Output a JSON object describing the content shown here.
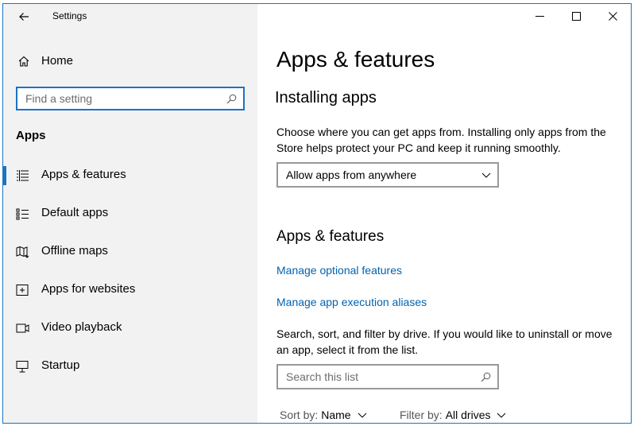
{
  "window": {
    "title": "Settings"
  },
  "sidebar": {
    "home_label": "Home",
    "search_placeholder": "Find a setting",
    "section_label": "Apps",
    "items": [
      {
        "label": "Apps & features",
        "icon": "apps-features-icon",
        "selected": true
      },
      {
        "label": "Default apps",
        "icon": "default-apps-icon",
        "selected": false
      },
      {
        "label": "Offline maps",
        "icon": "offline-maps-icon",
        "selected": false
      },
      {
        "label": "Apps for websites",
        "icon": "apps-websites-icon",
        "selected": false
      },
      {
        "label": "Video playback",
        "icon": "video-playback-icon",
        "selected": false
      },
      {
        "label": "Startup",
        "icon": "startup-icon",
        "selected": false
      }
    ]
  },
  "main": {
    "title": "Apps & features",
    "installing": {
      "heading": "Installing apps",
      "description": "Choose where you can get apps from. Installing only apps from the Store helps protect your PC and keep it running smoothly.",
      "dropdown_value": "Allow apps from anywhere"
    },
    "features": {
      "heading": "Apps & features",
      "link_optional": "Manage optional features",
      "link_aliases": "Manage app execution aliases",
      "description": "Search, sort, and filter by drive. If you would like to uninstall or move an app, select it from the list.",
      "search_placeholder": "Search this list",
      "sort_label": "Sort by:",
      "sort_value": "Name",
      "filter_label": "Filter by:",
      "filter_value": "All drives"
    }
  },
  "colors": {
    "accent": "#1a73c7",
    "link": "#0063b1",
    "sidebar_bg": "#f2f2f2"
  }
}
